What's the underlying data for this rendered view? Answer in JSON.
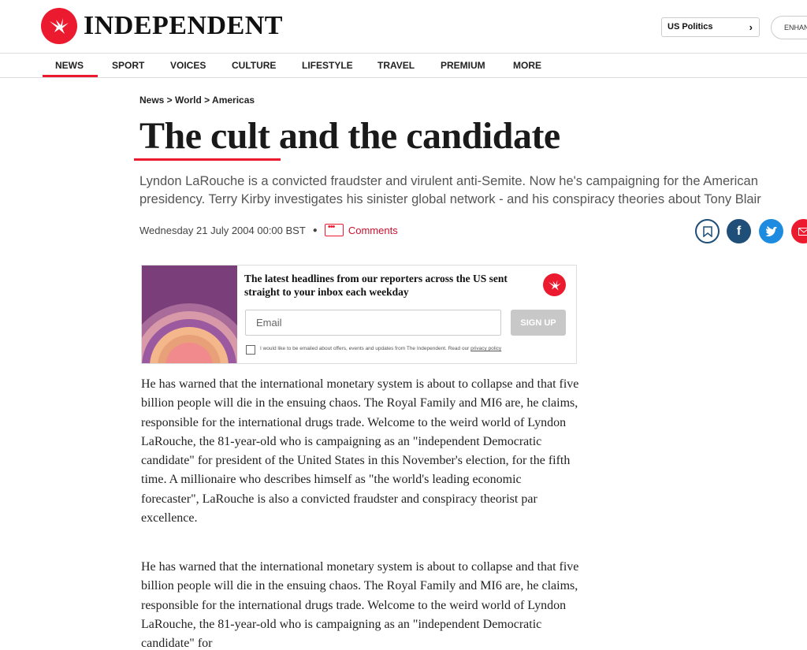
{
  "brand": {
    "name": "INDEPENDENT",
    "logo_icon": "eagle-icon",
    "accent": "#ec1a2e"
  },
  "topbar": {
    "topic_pill": "US Politics",
    "enhanced_pill": "ENHAN"
  },
  "nav": {
    "items": [
      "NEWS",
      "SPORT",
      "VOICES",
      "CULTURE",
      "LIFESTYLE",
      "TRAVEL",
      "PREMIUM",
      "MORE"
    ],
    "active": "NEWS"
  },
  "article": {
    "breadcrumb": "News > World > Americas",
    "headline": "The cult and the candidate",
    "standfirst": "Lyndon LaRouche is a convicted fraudster and virulent anti-Semite. Now he's campaigning for the American presidency. Terry Kirby investigates his sinister global network - and his conspiracy theories about Tony Blair",
    "date": "Wednesday 21 July 2004 00:00 BST",
    "comments_label": "Comments",
    "share_icons": [
      "bookmark-icon",
      "facebook-icon",
      "twitter-icon",
      "email-icon"
    ],
    "paragraphs": [
      "He has warned that the international monetary system is about to collapse and that five billion people will die in the ensuing chaos. The Royal Family and MI6 are, he claims, responsible for the international drugs trade. Welcome to the weird world of Lyndon LaRouche, the 81-year-old who is campaigning as an \"independent Democratic candidate\" for president of the United States in this November's election, for the fifth time. A millionaire who describes himself as \"the world's leading economic forecaster\", LaRouche is also a convicted fraudster and conspiracy theorist par excellence.",
      "He has warned that the international monetary system is about to collapse and that five billion people will die in the ensuing chaos. The Royal Family and MI6 are, he claims, responsible for the international drugs trade. Welcome to the weird world of Lyndon LaRouche, the 81-year-old who is campaigning as an \"independent Democratic candidate\" for"
    ]
  },
  "newsletter": {
    "headline": "The latest headlines from our reporters across the US sent straight to your inbox each weekday",
    "email_placeholder": "Email",
    "signup_label": "SIGN UP",
    "consent_text": "I would like to be emailed about offers, events and updates from The Independent. Read our ",
    "privacy_link": "privacy policy"
  }
}
